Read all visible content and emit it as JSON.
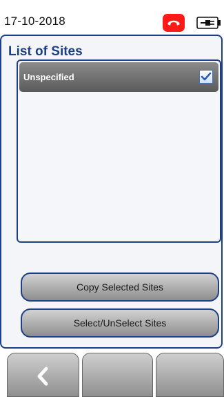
{
  "status_bar": {
    "date": "17-10-2018",
    "call_icon": "phone-hangup-icon",
    "battery_icon": "battery-plug-icon",
    "call_badge_color": "#ff1a1a"
  },
  "panel": {
    "title": "List of Sites",
    "sites": [
      {
        "label": "Unspecified",
        "selected": true
      }
    ]
  },
  "buttons": {
    "copy_label": "Copy Selected Sites",
    "select_label": "Select/UnSelect Sites"
  },
  "soft_keys": {
    "back_icon": "chevron-left-icon"
  },
  "colors": {
    "accent": "#1d3f86"
  }
}
